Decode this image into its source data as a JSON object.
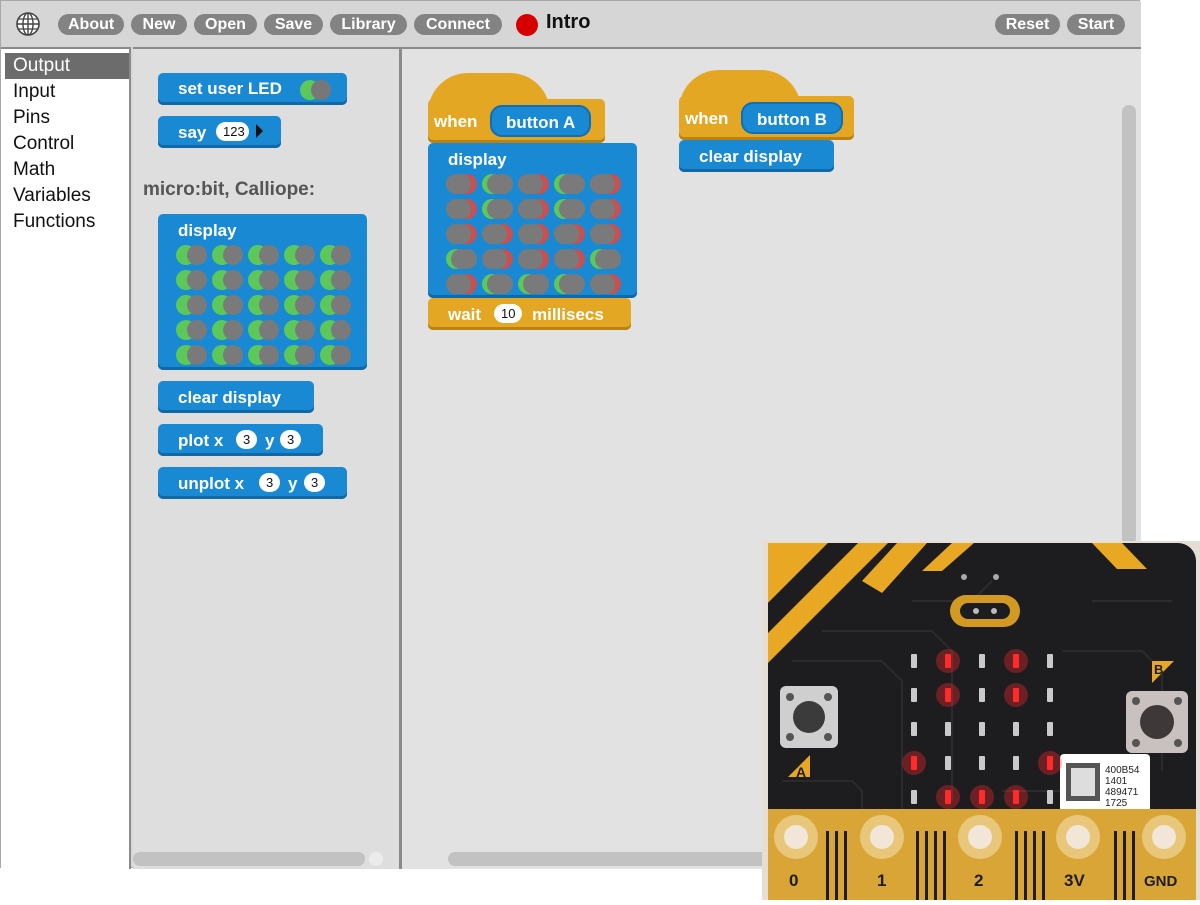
{
  "topbar": {
    "buttons": [
      "About",
      "New",
      "Open",
      "Save",
      "Library",
      "Connect"
    ],
    "project_name": "Intro",
    "right_buttons": [
      "Reset",
      "Start"
    ]
  },
  "categories": [
    "Output",
    "Input",
    "Pins",
    "Control",
    "Math",
    "Variables",
    "Functions"
  ],
  "selected_category": "Output",
  "palette": {
    "set_user_led": "set user LED",
    "say": "say",
    "say_value": "123",
    "section_header": "micro:bit, Calliope:",
    "display": "display",
    "clear_display": "clear display",
    "plot": {
      "label": "plot x",
      "x": "3",
      "y_label": "y",
      "y": "3"
    },
    "unplot": {
      "label": "unplot x",
      "x": "3",
      "y_label": "y",
      "y": "3"
    }
  },
  "scripts": {
    "script_a": {
      "when": "when",
      "button": "button A",
      "display": "display",
      "wait": "wait",
      "wait_value": "10",
      "wait_unit": "millisecs",
      "leds_on": [
        [
          false,
          true,
          false,
          true,
          false
        ],
        [
          false,
          true,
          false,
          true,
          false
        ],
        [
          false,
          false,
          false,
          false,
          false
        ],
        [
          true,
          false,
          false,
          false,
          true
        ],
        [
          false,
          true,
          true,
          true,
          false
        ]
      ]
    },
    "script_b": {
      "when": "when",
      "button": "button B",
      "clear_display": "clear display"
    }
  },
  "board": {
    "pin_labels": [
      "0",
      "1",
      "2",
      "3V",
      "GND"
    ],
    "button_labels": [
      "A",
      "B"
    ],
    "serial_lines": [
      "400B54",
      "1401",
      "489471",
      "1725"
    ]
  },
  "colors": {
    "output_blue": "#1a89d4",
    "control_gold": "#e3a723",
    "led_on": "#ff2a2a",
    "led_toggle_on": "#5cc85a",
    "led_toggle_off": "#c85050"
  }
}
